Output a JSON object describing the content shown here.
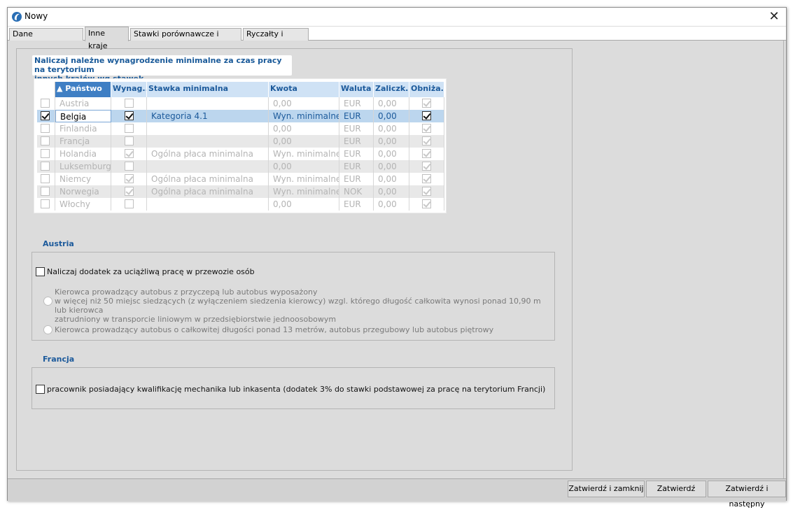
{
  "window": {
    "title": "Nowy"
  },
  "tabs": [
    {
      "label": "Dane podstawowe",
      "active": false
    },
    {
      "label": "Inne kraje",
      "active": true
    },
    {
      "label": "Stawki porównawcze i urlopy",
      "active": false
    },
    {
      "label": "Ryczałty i premie",
      "active": false
    }
  ],
  "notice": {
    "line1": "Naliczaj należne wynagrodzenie minimalne za czas pracy na terytorium",
    "line2": "innych krajów wg stawek"
  },
  "grid": {
    "columns": [
      "",
      "▲ Państwo",
      "Wynag...",
      "Stawka minimalna",
      "Kwota",
      "Waluta",
      "Zaliczk...",
      "Obniża..."
    ],
    "rows": [
      {
        "country": "Austria",
        "wyn": false,
        "stawka": "",
        "kwota": "0,00",
        "waluta": "EUR",
        "zal": "0,00",
        "obn": true,
        "selected": false
      },
      {
        "country": "Belgia",
        "wyn": true,
        "stawka": "Kategoria 4.1",
        "kwota": "Wyn. minimalne",
        "waluta": "EUR",
        "zal": "0,00",
        "obn": true,
        "selected": true
      },
      {
        "country": "Finlandia",
        "wyn": false,
        "stawka": "",
        "kwota": "0,00",
        "waluta": "EUR",
        "zal": "0,00",
        "obn": true,
        "selected": false
      },
      {
        "country": "Francja",
        "wyn": false,
        "stawka": "",
        "kwota": "0,00",
        "waluta": "EUR",
        "zal": "0,00",
        "obn": true,
        "selected": false
      },
      {
        "country": "Holandia",
        "wyn": true,
        "stawka": "Ogólna płaca minimalna",
        "kwota": "Wyn. minimalne",
        "waluta": "EUR",
        "zal": "0,00",
        "obn": true,
        "selected": false
      },
      {
        "country": "Luksemburg",
        "wyn": false,
        "stawka": "",
        "kwota": "0,00",
        "waluta": "EUR",
        "zal": "0,00",
        "obn": true,
        "selected": false
      },
      {
        "country": "Niemcy",
        "wyn": true,
        "stawka": "Ogólna płaca minimalna",
        "kwota": "Wyn. minimalne",
        "waluta": "EUR",
        "zal": "0,00",
        "obn": true,
        "selected": false
      },
      {
        "country": "Norwegia",
        "wyn": true,
        "stawka": "Ogólna płaca minimalna",
        "kwota": "Wyn. minimalne",
        "waluta": "NOK",
        "zal": "0,00",
        "obn": true,
        "selected": false
      },
      {
        "country": "Włochy",
        "wyn": false,
        "stawka": "",
        "kwota": "0,00",
        "waluta": "EUR",
        "zal": "0,00",
        "obn": true,
        "selected": false
      }
    ]
  },
  "austria": {
    "title": "Austria",
    "checkbox_label": "Naliczaj dodatek za uciążliwą pracę w przewozie osób",
    "radio1_line1": "Kierowca prowadzący autobus z przyczepą lub autobus wyposażony",
    "radio1_line2": " w więcej niż 50 miejsc siedzących (z wyłączeniem siedzenia kierowcy) wzgl. którego długość całkowita wynosi ponad 10,90 m lub kierowca",
    "radio1_line3": "zatrudniony w transporcie liniowym w przedsiębiorstwie jednoosobowym",
    "radio2": "Kierowca prowadzący autobus o całkowitej długości ponad 13 metrów, autobus przegubowy lub autobus piętrowy"
  },
  "francja": {
    "title": "Francja",
    "checkbox_label": "pracownik posiadający kwalifikację mechanika lub inkasenta (dodatek 3% do stawki podstawowej za pracę na terytorium Francji)"
  },
  "buttons": {
    "confirm_close": "Zatwierdź i zamknij",
    "confirm": "Zatwierdź",
    "confirm_next": "Zatwierdź i następny"
  }
}
